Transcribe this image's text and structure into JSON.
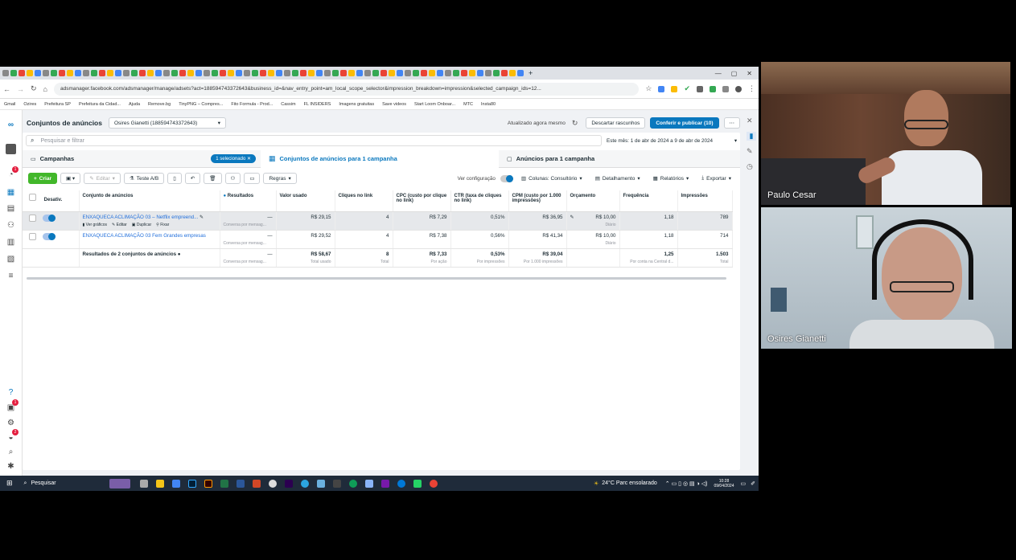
{
  "browser": {
    "url": "adsmanager.facebook.com/adsmanager/manage/adsets?act=188594743372643&business_id=&nav_entry_point=am_local_scope_selector&impression_breakdown=impression&selected_campaign_ids=12...",
    "window_controls": [
      "—",
      "▢",
      "✕"
    ]
  },
  "bookmarks": [
    "Gmail",
    "Ozires",
    "Prefeitura SP",
    "Prefeitura da Cidad...",
    "Ajuda",
    "Remove.bg",
    "TinyPNG – Compres...",
    "Fito Formula - Prod...",
    "Cassim",
    "FL INSIDERS",
    "Imagens gratuitas",
    "Save videos",
    "Start Loom Onboar...",
    "MTC",
    "Insta80"
  ],
  "header": {
    "title": "Conjuntos de anúncios",
    "account": "Osires Gianetti (188594743372643)",
    "updated": "Atualizado agora mesmo",
    "discard": "Descartar rascunhos",
    "publish": "Conferir e publicar (10)"
  },
  "search": {
    "placeholder": "Pesquisar e filtrar",
    "date_range": "Este mês: 1 de abr de 2024 a 9 de abr de 2024"
  },
  "tabs": {
    "campaigns": "Campanhas",
    "selected_chip": "1 selecionado",
    "adsets": "Conjuntos de anúncios para 1 campanha",
    "ads": "Anúncios para 1 campanha"
  },
  "toolbar": {
    "create": "Criar",
    "edit": "Editar",
    "ab_test": "Teste A/B",
    "rules": "Regras",
    "view_config": "Ver configuração",
    "columns": "Colunas: Consultório",
    "breakdown": "Detalhamento",
    "reports": "Relatórios",
    "export": "Exportar"
  },
  "table": {
    "headers": [
      "Desativ.",
      "Conjunto de anúncios",
      "Resultados",
      "Valor usado",
      "Cliques no link",
      "CPC (custo por clique no link)",
      "CTR (taxa de cliques no link)",
      "CPM (custo por 1.000 impressões)",
      "Orçamento",
      "Frequência",
      "Impressões"
    ],
    "rows": [
      {
        "name": "ENXAQUECA ACLIMAÇÃO 03 – Netflix empreend...",
        "actions": [
          "Ver gráficos",
          "Editar",
          "Duplicar",
          "Fixar"
        ],
        "results": "—",
        "results_sub": "Conversa por mensag...",
        "spent": "R$ 29,15",
        "clicks": "4",
        "cpc": "R$ 7,29",
        "ctr": "0,51%",
        "cpm": "R$ 36,95",
        "budget": "R$ 10,00",
        "budget_sub": "Diário",
        "freq": "1,18",
        "impr": "789"
      },
      {
        "name": "ENXAQUECA ACLIMAÇÃO 03 Fem Grandes empresas",
        "actions": [],
        "results": "—",
        "results_sub": "Conversa por mensag...",
        "spent": "R$ 29,52",
        "clicks": "4",
        "cpc": "R$ 7,38",
        "ctr": "0,56%",
        "cpm": "R$ 41,34",
        "budget": "R$ 10,00",
        "budget_sub": "Diário",
        "freq": "1,18",
        "impr": "714"
      }
    ],
    "totals": {
      "label": "Resultados de 2 conjuntos de anúncios",
      "results": "—",
      "results_sub": "Conversa por mensag...",
      "spent": "R$ 58,67",
      "spent_sub": "Total usado",
      "clicks": "8",
      "clicks_sub": "Total",
      "cpc": "R$ 7,33",
      "cpc_sub": "Por ação",
      "ctr": "0,53%",
      "ctr_sub": "Por impressões",
      "cpm": "R$ 39,04",
      "cpm_sub": "Por 1.000 impressões",
      "freq": "1,25",
      "freq_sub": "Por conta na Central d...",
      "impr": "1.503",
      "impr_sub": "Total"
    }
  },
  "taskbar": {
    "search": "Pesquisar",
    "weather": "24°C  Parc ensolarado",
    "time": "10:28",
    "date": "09/04/2024"
  },
  "participants": [
    {
      "name": "Paulo Cesar"
    },
    {
      "name": "Osires Gianetti"
    }
  ],
  "colors": {
    "brand": "#0a78be",
    "create": "#42b72a"
  }
}
